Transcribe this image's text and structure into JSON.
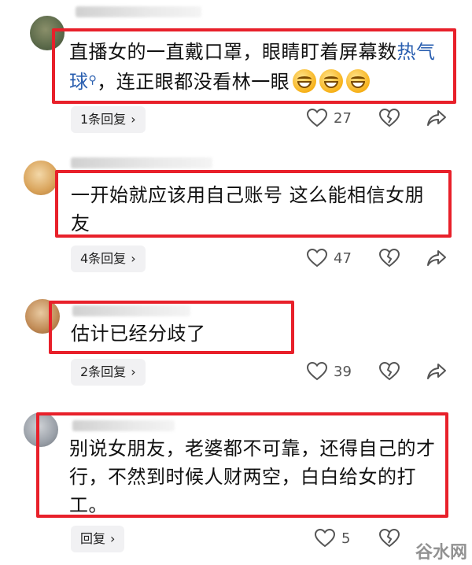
{
  "comments": [
    {
      "text_line1_a": "直播女的一直戴口罩，眼睛盯着屏幕数",
      "link": "热气球",
      "text_line2_b": "，连正眼都没看林一眼",
      "emoji_count": 3,
      "reply_label": "1条回复",
      "likes": "27"
    },
    {
      "text": "一开始就应该用自己账号 这么能相信女朋友",
      "reply_label": "4条回复",
      "likes": "47"
    },
    {
      "text": "估计已经分歧了",
      "reply_label": "2条回复",
      "likes": "39"
    },
    {
      "text": "别说女朋友，老婆都不可靠，还得自己的才行，不然到时候人财两空，白白给女的打工。",
      "reply_label": "回复",
      "likes": "5"
    }
  ],
  "icons": {
    "like": "heart-outline-icon",
    "dislike": "broken-heart-icon",
    "share": "share-arrow-icon"
  },
  "colors": {
    "highlight": "#e8202a",
    "link": "#2a5fb0"
  },
  "watermark": {
    "text": "谷水网"
  }
}
